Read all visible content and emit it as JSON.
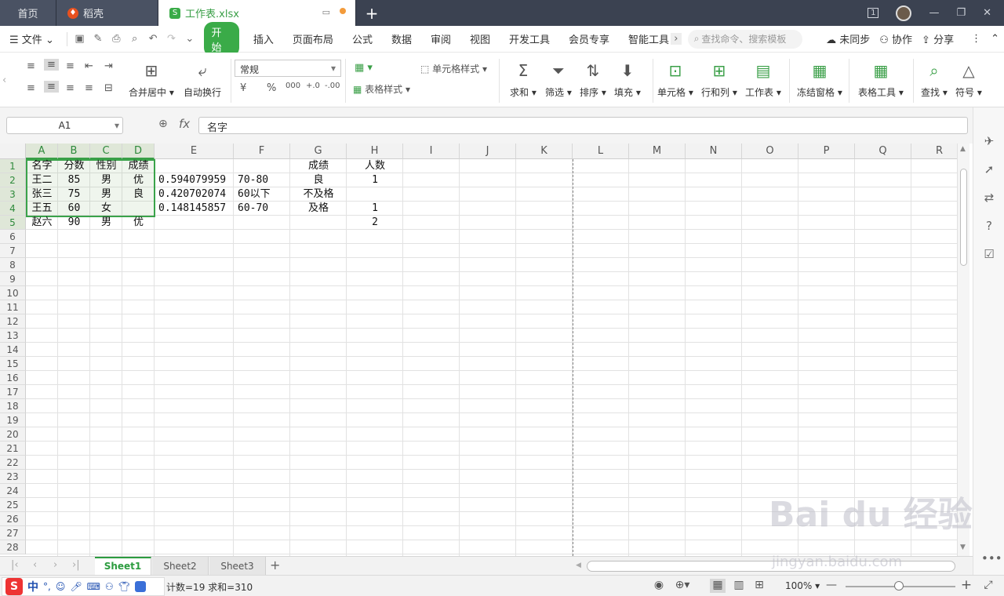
{
  "titlebar": {
    "tabs": [
      {
        "label": "首页"
      },
      {
        "label": "稻壳"
      },
      {
        "label": "工作表.xlsx"
      }
    ],
    "plus": "+",
    "page_indicator": "1",
    "minimize": "—",
    "restore": "❐",
    "close": "✕"
  },
  "menubar": {
    "file": "文件",
    "tabs": [
      "开始",
      "插入",
      "页面布局",
      "公式",
      "数据",
      "审阅",
      "视图",
      "开发工具",
      "会员专享",
      "智能工具"
    ],
    "search_placeholder": "查找命令、搜索模板",
    "unsync": "未同步",
    "collab": "协作",
    "share": "分享"
  },
  "ribbon": {
    "merge_center": "合并居中",
    "wrap_text": "自动换行",
    "number_format": "常规",
    "cell_style": "单元格样式",
    "table_style": "表格样式",
    "sum": "求和",
    "filter": "筛选",
    "sort": "排序",
    "fill": "填充",
    "cell": "单元格",
    "row_col": "行和列",
    "worksheet": "工作表",
    "freeze": "冻结窗格",
    "table_tools": "表格工具",
    "find": "查找",
    "symbol": "符号",
    "currency": "¥",
    "percent": "%",
    "thousands": "000",
    "inc_decimal": "+.0",
    "dec_decimal": "-.00"
  },
  "formula": {
    "namebox": "A1",
    "fx": "fx",
    "value": "名字"
  },
  "grid": {
    "columns": [
      "A",
      "B",
      "C",
      "D",
      "E",
      "F",
      "G",
      "H",
      "I",
      "J",
      "K",
      "L",
      "M",
      "N",
      "O",
      "P",
      "Q",
      "R"
    ],
    "rows": [
      "1",
      "2",
      "3",
      "4",
      "5",
      "6",
      "7",
      "8",
      "9",
      "10",
      "11",
      "12",
      "13",
      "14",
      "15",
      "16",
      "17",
      "18",
      "19",
      "20",
      "21",
      "22",
      "23",
      "24",
      "25",
      "26",
      "27",
      "28"
    ],
    "cells": {
      "A1": "名字",
      "B1": "分数",
      "C1": "性别",
      "D1": "成绩",
      "G1": "成绩",
      "H1": "人数",
      "A2": "王二",
      "B2": "85",
      "C2": "男",
      "D2": "优",
      "E2": "0.594079959",
      "F2": "70-80",
      "G2": "良",
      "H2": "1",
      "A3": "张三",
      "B3": "75",
      "C3": "男",
      "D3": "良",
      "E3": "0.420702074",
      "F3": "60以下",
      "G3": "不及格",
      "A4": "王五",
      "B4": "60",
      "C4": "女",
      "E4": "0.148145857",
      "F4": "60-70",
      "G4": "及格",
      "H4": "1",
      "A5": "赵六",
      "B5": "90",
      "C5": "男",
      "D5": "优",
      "H5": "2"
    }
  },
  "sheets": [
    "Sheet1",
    "Sheet2",
    "Sheet3"
  ],
  "sheet_add": "+",
  "status": {
    "text": "计数=19  求和=310",
    "zoom": "100%",
    "zoom_minus": "—",
    "zoom_plus": "+",
    "ime_s": "S",
    "ime_lang": "中"
  },
  "watermark": {
    "main": "Bai du 经验",
    "sub": "jingyan.baidu.com"
  },
  "colors": {
    "accent": "#3aab48",
    "titlebar": "#3b4251"
  }
}
